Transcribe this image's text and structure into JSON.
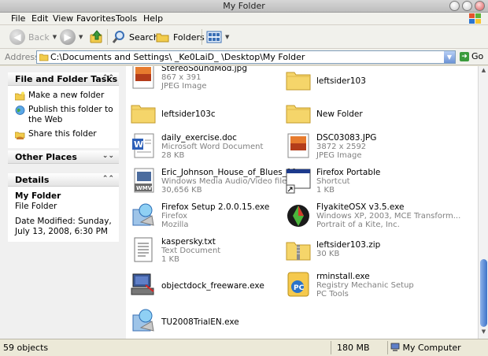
{
  "window": {
    "title": "My Folder"
  },
  "menu": [
    "File",
    "Edit",
    "View",
    "Favorites",
    "Tools",
    "Help"
  ],
  "toolbar": {
    "back_label": "Back",
    "search_label": "Search",
    "folders_label": "Folders"
  },
  "address": {
    "label": "Address",
    "path": "C:\\Documents and Settings\\ _Ke0LaiD_ \\Desktop\\My Folder",
    "go_label": "Go"
  },
  "tasks": {
    "file_folder": {
      "title": "File and Folder Tasks",
      "items": [
        "Make a new folder",
        "Publish this folder to the Web",
        "Share this folder"
      ]
    },
    "other_places": {
      "title": "Other Places"
    },
    "details": {
      "title": "Details",
      "name": "My Folder",
      "type": "File Folder",
      "modified": "Date Modified: Sunday, July 13, 2008, 6:30 PM"
    }
  },
  "files": [
    {
      "name": "StereoSoundMod.jpg",
      "line2": "867 x 391",
      "line3": "JPEG Image",
      "icon": "jpeg-icon"
    },
    {
      "name": "leftsider103",
      "line2": "",
      "line3": "",
      "icon": "folder-icon"
    },
    {
      "name": "leftsider103c",
      "line2": "",
      "line3": "",
      "icon": "folder-icon"
    },
    {
      "name": "New Folder",
      "line2": "",
      "line3": "",
      "icon": "folder-icon"
    },
    {
      "name": "daily_exercise.doc",
      "line2": "Microsoft Word Document",
      "line3": "28 KB",
      "icon": "word-doc-icon"
    },
    {
      "name": "DSC03083.JPG",
      "line2": "3872 x 2592",
      "line3": "JPEG Image",
      "icon": "jpeg-icon"
    },
    {
      "name": "Eric_Johnson_House_of_Blues_11_...",
      "line2": "Windows Media Audio/Video file",
      "line3": "30,656 KB",
      "icon": "wmv-icon"
    },
    {
      "name": "Firefox Portable",
      "line2": "Shortcut",
      "line3": "1 KB",
      "icon": "shortcut-icon"
    },
    {
      "name": "Firefox Setup 2.0.0.15.exe",
      "line2": "Firefox",
      "line3": "Mozilla",
      "icon": "installer-icon"
    },
    {
      "name": "FlyakiteOSX v3.5.exe",
      "line2": "Windows XP, 2003, MCE Transform...",
      "line3": "Portrait of a Kite, Inc.",
      "icon": "flyakite-icon"
    },
    {
      "name": "kaspersky.txt",
      "line2": "Text Document",
      "line3": "1 KB",
      "icon": "text-doc-icon"
    },
    {
      "name": "leftsider103.zip",
      "line2": "30 KB",
      "line3": "",
      "icon": "zip-folder-icon"
    },
    {
      "name": "objectdock_freeware.exe",
      "line2": "",
      "line3": "",
      "icon": "computer-installer-icon"
    },
    {
      "name": "rminstall.exe",
      "line2": "Registry Mechanic Setup",
      "line3": "PC Tools",
      "icon": "pc-tools-icon"
    },
    {
      "name": "TU2008TrialEN.exe",
      "line2": "",
      "line3": "",
      "icon": "installer-icon"
    }
  ],
  "status": {
    "objects": "59 objects",
    "size": "180 MB",
    "location": "My Computer"
  }
}
